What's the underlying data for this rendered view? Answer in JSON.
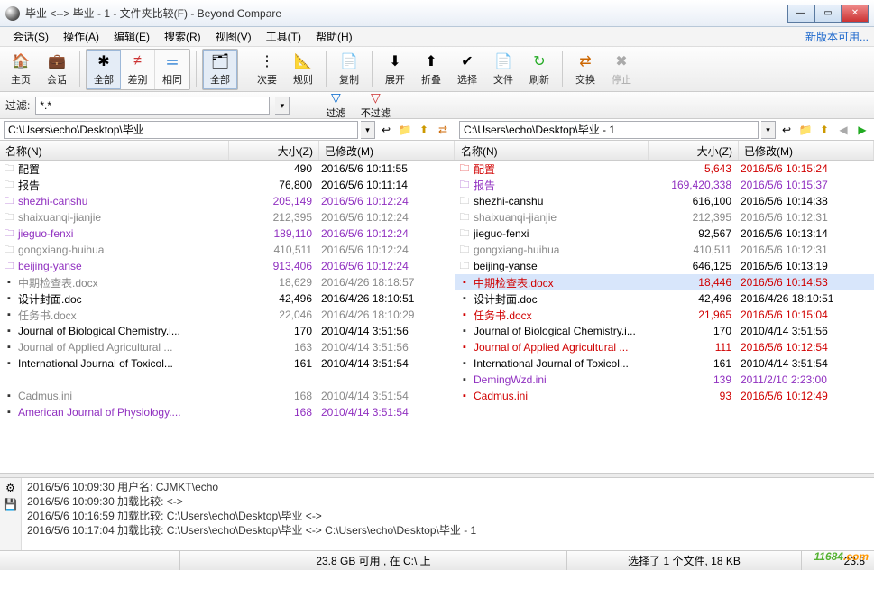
{
  "window": {
    "title": "毕业 <--> 毕业 - 1 - 文件夹比较(F) - Beyond Compare"
  },
  "menu": {
    "items": [
      "会话(S)",
      "操作(A)",
      "编辑(E)",
      "搜索(R)",
      "视图(V)",
      "工具(T)",
      "帮助(H)"
    ],
    "update_link": "新版本可用..."
  },
  "toolbar": {
    "home": "主页",
    "sessions": "会话",
    "all": "全部",
    "diff": "差别",
    "same": "相同",
    "all2": "全部",
    "rules": "次要",
    "rules2": "规则",
    "copy": "复制",
    "expand": "展开",
    "collapse": "折叠",
    "select": "选择",
    "files": "文件",
    "refresh": "刷新",
    "swap": "交换",
    "stop": "停止"
  },
  "filter": {
    "label": "过滤:",
    "value": "*.*",
    "btn_filter": "过滤",
    "btn_nofilter": "不过滤"
  },
  "paths": {
    "left": "C:\\Users\\echo\\Desktop\\毕业",
    "right": "C:\\Users\\echo\\Desktop\\毕业 - 1"
  },
  "columns": {
    "name": "名称(N)",
    "size": "大小(Z)",
    "modified": "已修改(M)"
  },
  "left_files": [
    {
      "icon": "folder",
      "color": "black",
      "name": "配置",
      "size": "490",
      "date": "2016/5/6 10:11:55"
    },
    {
      "icon": "folder",
      "color": "black",
      "name": "报告",
      "size": "76,800",
      "date": "2016/5/6 10:11:14"
    },
    {
      "icon": "folder-p",
      "color": "purple",
      "name": "shezhi-canshu",
      "size": "205,149",
      "date": "2016/5/6 10:12:24"
    },
    {
      "icon": "folder",
      "color": "gray",
      "name": "shaixuanqi-jianjie",
      "size": "212,395",
      "date": "2016/5/6 10:12:24"
    },
    {
      "icon": "folder-p",
      "color": "purple",
      "name": "jieguo-fenxi",
      "size": "189,110",
      "date": "2016/5/6 10:12:24"
    },
    {
      "icon": "folder",
      "color": "gray",
      "name": "gongxiang-huihua",
      "size": "410,511",
      "date": "2016/5/6 10:12:24"
    },
    {
      "icon": "folder-p",
      "color": "purple",
      "name": "beijing-yanse",
      "size": "913,406",
      "date": "2016/5/6 10:12:24"
    },
    {
      "icon": "file",
      "color": "gray",
      "name": "中期检查表.docx",
      "size": "18,629",
      "date": "2016/4/26 18:18:57"
    },
    {
      "icon": "file",
      "color": "black",
      "name": "设计封面.doc",
      "size": "42,496",
      "date": "2016/4/26 18:10:51"
    },
    {
      "icon": "file",
      "color": "gray",
      "name": "任务书.docx",
      "size": "22,046",
      "date": "2016/4/26 18:10:29"
    },
    {
      "icon": "file",
      "color": "black",
      "name": "Journal of Biological Chemistry.i...",
      "size": "170",
      "date": "2010/4/14 3:51:56"
    },
    {
      "icon": "file",
      "color": "gray",
      "name": "Journal of Applied Agricultural ...",
      "size": "163",
      "date": "2010/4/14 3:51:56"
    },
    {
      "icon": "file",
      "color": "black",
      "name": "International Journal of Toxicol...",
      "size": "161",
      "date": "2010/4/14 3:51:54"
    },
    {
      "icon": "blank",
      "color": "black",
      "name": "",
      "size": "",
      "date": ""
    },
    {
      "icon": "file",
      "color": "gray",
      "name": "Cadmus.ini",
      "size": "168",
      "date": "2010/4/14 3:51:54"
    },
    {
      "icon": "file",
      "color": "purple",
      "name": "American Journal of Physiology....",
      "size": "168",
      "date": "2010/4/14 3:51:54"
    }
  ],
  "right_files": [
    {
      "icon": "folder-r",
      "color": "red",
      "name": "配置",
      "size": "5,643",
      "date": "2016/5/6 10:15:24"
    },
    {
      "icon": "folder-p",
      "color": "purple",
      "name": "报告",
      "size": "169,420,338",
      "date": "2016/5/6 10:15:37"
    },
    {
      "icon": "folder",
      "color": "black",
      "name": "shezhi-canshu",
      "size": "616,100",
      "date": "2016/5/6 10:14:38"
    },
    {
      "icon": "folder",
      "color": "gray",
      "name": "shaixuanqi-jianjie",
      "size": "212,395",
      "date": "2016/5/6 10:12:31"
    },
    {
      "icon": "folder",
      "color": "black",
      "name": "jieguo-fenxi",
      "size": "92,567",
      "date": "2016/5/6 10:13:14"
    },
    {
      "icon": "folder",
      "color": "gray",
      "name": "gongxiang-huihua",
      "size": "410,511",
      "date": "2016/5/6 10:12:31"
    },
    {
      "icon": "folder",
      "color": "black",
      "name": "beijing-yanse",
      "size": "646,125",
      "date": "2016/5/6 10:13:19"
    },
    {
      "icon": "file-r",
      "color": "red",
      "name": "中期检查表.docx",
      "size": "18,446",
      "date": "2016/5/6 10:14:53",
      "selected": true
    },
    {
      "icon": "file",
      "color": "black",
      "name": "设计封面.doc",
      "size": "42,496",
      "date": "2016/4/26 18:10:51"
    },
    {
      "icon": "file-r",
      "color": "red",
      "name": "任务书.docx",
      "size": "21,965",
      "date": "2016/5/6 10:15:04"
    },
    {
      "icon": "file",
      "color": "black",
      "name": "Journal of Biological Chemistry.i...",
      "size": "170",
      "date": "2010/4/14 3:51:56"
    },
    {
      "icon": "file-r",
      "color": "red",
      "name": "Journal of Applied Agricultural ...",
      "size": "111",
      "date": "2016/5/6 10:12:54"
    },
    {
      "icon": "file",
      "color": "black",
      "name": "International Journal of Toxicol...",
      "size": "161",
      "date": "2010/4/14 3:51:54"
    },
    {
      "icon": "file",
      "color": "purple",
      "name": "DemingWzd.ini",
      "size": "139",
      "date": "2011/2/10 2:23:00"
    },
    {
      "icon": "file-r",
      "color": "red",
      "name": "Cadmus.ini",
      "size": "93",
      "date": "2016/5/6 10:12:49"
    }
  ],
  "log": [
    "2016/5/6 10:09:30  用户名: CJMKT\\echo",
    "2016/5/6 10:09:30  加载比较:  <->",
    "2016/5/6 10:16:59  加载比较: C:\\Users\\echo\\Desktop\\毕业 <->",
    "2016/5/6 10:17:04  加载比较: C:\\Users\\echo\\Desktop\\毕业 <-> C:\\Users\\echo\\Desktop\\毕业 - 1"
  ],
  "status": {
    "left_space": "23.8 GB 可用 , 在 C:\\ 上",
    "selection": "选择了 1 个文件, 18 KB",
    "right_space": "23.8"
  },
  "watermark": "11684.com"
}
